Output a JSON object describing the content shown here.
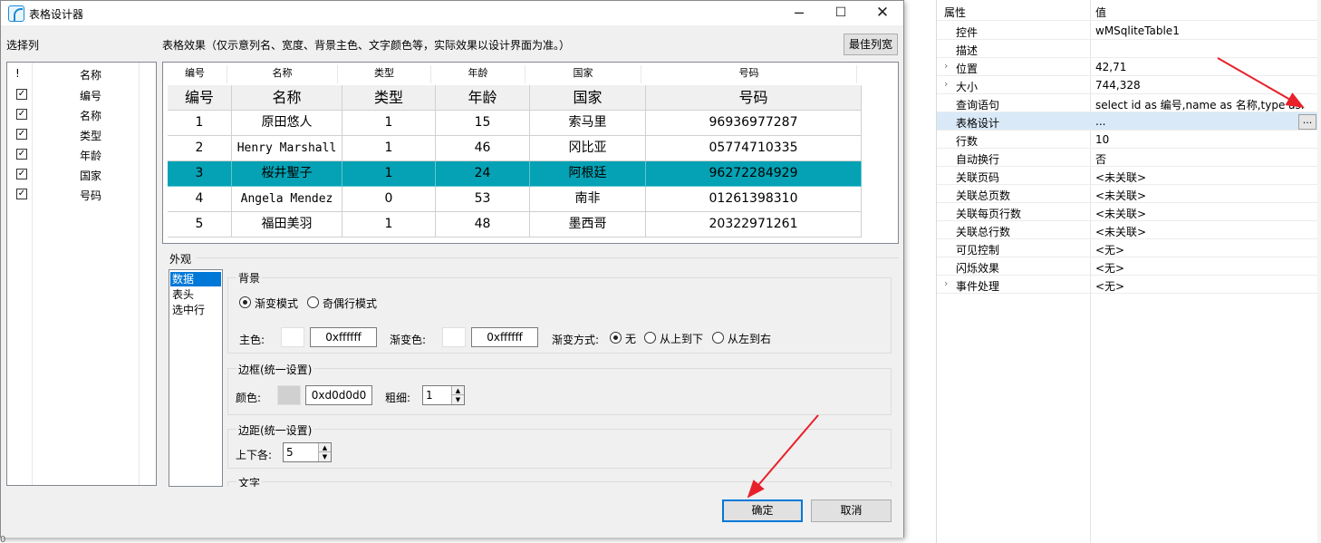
{
  "dialog": {
    "title": "表格设计器",
    "select_col_label": "选择列",
    "effect_label": "表格效果（仅示意列名、宽度、背景主色、文字颜色等，实际效果以设计界面为准。）",
    "best_width_button": "最佳列宽",
    "minimize": "─",
    "maximize": "☐",
    "close": "✕"
  },
  "column_list": {
    "header_check": "!",
    "header_name": "名称",
    "items": [
      {
        "name": "编号",
        "checked": true
      },
      {
        "name": "名称",
        "checked": true
      },
      {
        "name": "类型",
        "checked": true
      },
      {
        "name": "年龄",
        "checked": true
      },
      {
        "name": "国家",
        "checked": true
      },
      {
        "name": "号码",
        "checked": true
      }
    ]
  },
  "preview": {
    "small_headers": [
      "编号",
      "名称",
      "类型",
      "年龄",
      "国家",
      "号码"
    ],
    "big_headers": [
      "编号",
      "名称",
      "类型",
      "年龄",
      "国家",
      "号码"
    ],
    "rows": [
      [
        "1",
        "原田悠人",
        "1",
        "15",
        "索马里",
        "96936977287"
      ],
      [
        "2",
        "Henry Marshall",
        "1",
        "46",
        "冈比亚",
        "05774710335"
      ],
      [
        "3",
        "桜井聖子",
        "1",
        "24",
        "阿根廷",
        "96272284929"
      ],
      [
        "4",
        "Angela Mendez",
        "0",
        "53",
        "南非",
        "01261398310"
      ],
      [
        "5",
        "福田美羽",
        "1",
        "48",
        "墨西哥",
        "20322971261"
      ]
    ],
    "selected_row": 2,
    "selected_color": "#04a2b4"
  },
  "appearance": {
    "label": "外观",
    "tabs": [
      "数据",
      "表头",
      "选中行"
    ],
    "active_tab": 0,
    "background": {
      "title": "背景",
      "mode_gradient": "渐变模式",
      "mode_oddeven": "奇偶行模式",
      "main_color_label": "主色:",
      "main_color_value": "0xffffff",
      "gradient_color_label": "渐变色:",
      "gradient_color_value": "0xffffff",
      "gradient_method_label": "渐变方式:",
      "method_none": "无",
      "method_top_bottom": "从上到下",
      "method_left_right": "从左到右"
    },
    "border": {
      "title": "边框(统一设置)",
      "color_label": "颜色:",
      "color_value": "0xd0d0d0",
      "swatch": "#d0d0d0",
      "thickness_label": "粗细:",
      "thickness_value": "1"
    },
    "margin": {
      "title": "边距(统一设置)",
      "vertical_label": "上下各:",
      "vertical_value": "5"
    },
    "text": {
      "title": "文字"
    }
  },
  "footer": {
    "ok": "确定",
    "cancel": "取消"
  },
  "properties": {
    "header_key": "属性",
    "header_value": "值",
    "rows": [
      {
        "k": "控件",
        "v": "wMSqliteTable1",
        "exp": ""
      },
      {
        "k": "描述",
        "v": "",
        "exp": ""
      },
      {
        "k": "位置",
        "v": "42,71",
        "exp": "›"
      },
      {
        "k": "大小",
        "v": "744,328",
        "exp": "›"
      },
      {
        "k": "查询语句",
        "v": "select id as 编号,name as 名称,type as...",
        "exp": ""
      },
      {
        "k": "表格设计",
        "v": "...",
        "exp": ""
      },
      {
        "k": "行数",
        "v": "10",
        "exp": ""
      },
      {
        "k": "自动换行",
        "v": "否",
        "exp": ""
      },
      {
        "k": "关联页码",
        "v": "<未关联>",
        "exp": ""
      },
      {
        "k": "关联总页数",
        "v": "<未关联>",
        "exp": ""
      },
      {
        "k": "关联每页行数",
        "v": "<未关联>",
        "exp": ""
      },
      {
        "k": "关联总行数",
        "v": "<未关联>",
        "exp": ""
      },
      {
        "k": "可见控制",
        "v": "<无>",
        "exp": ""
      },
      {
        "k": "闪烁效果",
        "v": "<无>",
        "exp": ""
      },
      {
        "k": "事件处理",
        "v": "<无>",
        "exp": "›"
      }
    ],
    "ellipsis_button": "..."
  },
  "edge_mark": "0"
}
